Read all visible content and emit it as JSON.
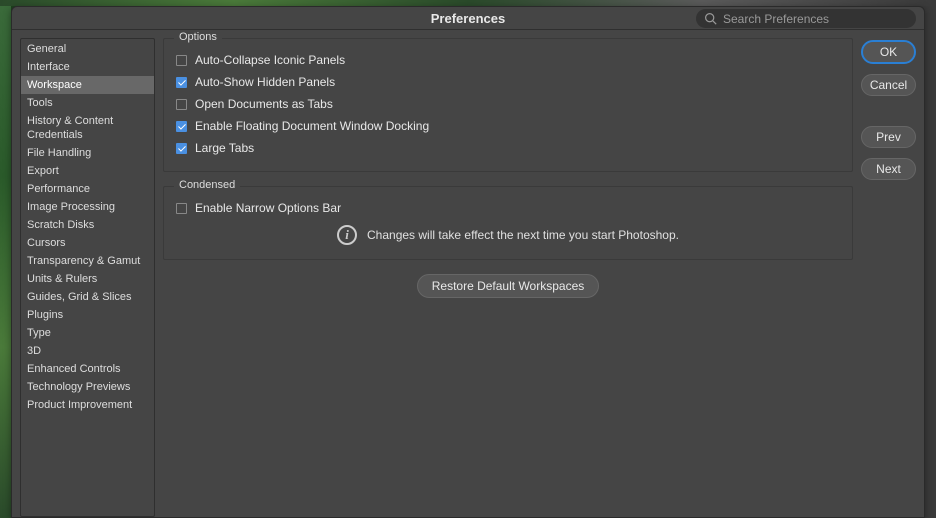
{
  "title": "Preferences",
  "search": {
    "placeholder": "Search Preferences"
  },
  "sidebar": {
    "items": [
      {
        "label": "General"
      },
      {
        "label": "Interface"
      },
      {
        "label": "Workspace",
        "selected": true
      },
      {
        "label": "Tools"
      },
      {
        "label": "History & Content Credentials"
      },
      {
        "label": "File Handling"
      },
      {
        "label": "Export"
      },
      {
        "label": "Performance"
      },
      {
        "label": "Image Processing"
      },
      {
        "label": "Scratch Disks"
      },
      {
        "label": "Cursors"
      },
      {
        "label": "Transparency & Gamut"
      },
      {
        "label": "Units & Rulers"
      },
      {
        "label": "Guides, Grid & Slices"
      },
      {
        "label": "Plugins"
      },
      {
        "label": "Type"
      },
      {
        "label": "3D"
      },
      {
        "label": "Enhanced Controls"
      },
      {
        "label": "Technology Previews"
      },
      {
        "label": "Product Improvement"
      }
    ]
  },
  "groups": {
    "options": {
      "legend": "Options",
      "items": [
        {
          "label": "Auto-Collapse Iconic Panels",
          "checked": false
        },
        {
          "label": "Auto-Show Hidden Panels",
          "checked": true
        },
        {
          "label": "Open Documents as Tabs",
          "checked": false
        },
        {
          "label": "Enable Floating Document Window Docking",
          "checked": true
        },
        {
          "label": "Large Tabs",
          "checked": true
        }
      ]
    },
    "condensed": {
      "legend": "Condensed",
      "items": [
        {
          "label": "Enable Narrow Options Bar",
          "checked": false
        }
      ],
      "info": "Changes will take effect the next time you start Photoshop."
    }
  },
  "buttons": {
    "restore": "Restore Default Workspaces",
    "ok": "OK",
    "cancel": "Cancel",
    "prev": "Prev",
    "next": "Next"
  }
}
